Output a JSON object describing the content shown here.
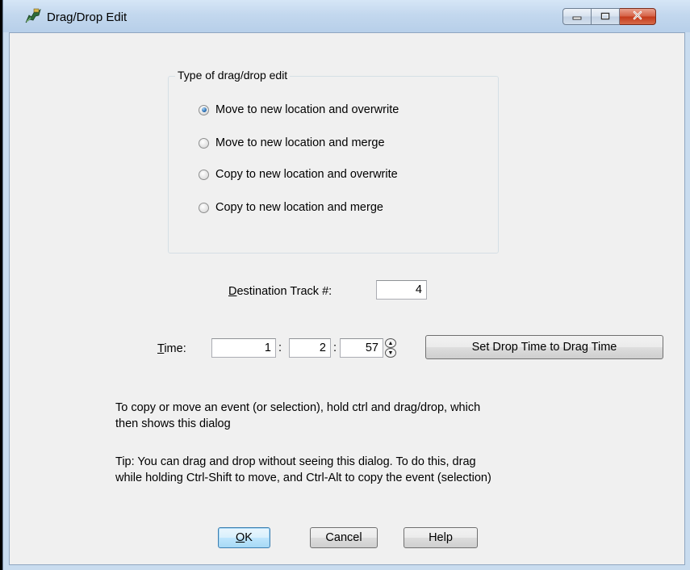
{
  "window": {
    "title": "Drag/Drop Edit",
    "icon": "drag-drop-app-icon",
    "caption_buttons": {
      "minimize": "minimize-icon",
      "maximize": "maximize-icon",
      "close": "close-icon"
    }
  },
  "group": {
    "legend": "Type of drag/drop edit",
    "options": [
      {
        "label": "Move to new location and overwrite",
        "checked": true
      },
      {
        "label": "Move to new location and merge",
        "checked": false
      },
      {
        "label": "Copy to new location and overwrite",
        "checked": false
      },
      {
        "label": "Copy to new location and merge",
        "checked": false
      }
    ]
  },
  "destination": {
    "label_first": "D",
    "label_rest": "estination Track #:",
    "value": "4"
  },
  "time": {
    "label_first": "T",
    "label_rest": "ime:",
    "separator": ":",
    "bar": "1",
    "beat": "2",
    "tick": "57"
  },
  "buttons": {
    "set_drop": "Set Drop Time to Drag Time",
    "ok_first": "O",
    "ok_rest": "K",
    "cancel": "Cancel",
    "help": "Help"
  },
  "info": {
    "line1": "To copy or move an event (or selection), hold ctrl and drag/drop, which",
    "line2": "then shows this dialog",
    "tip1": "Tip: You can drag and drop without seeing this dialog. To do this, drag",
    "tip2": "while holding Ctrl-Shift to move, and Ctrl-Alt to copy the event (selection)"
  },
  "colors": {
    "title_bar": "#c3d8ee",
    "client_bg": "#f0f0f0",
    "close_red": "#c3391a",
    "default_button_border": "#3c7fb1"
  }
}
